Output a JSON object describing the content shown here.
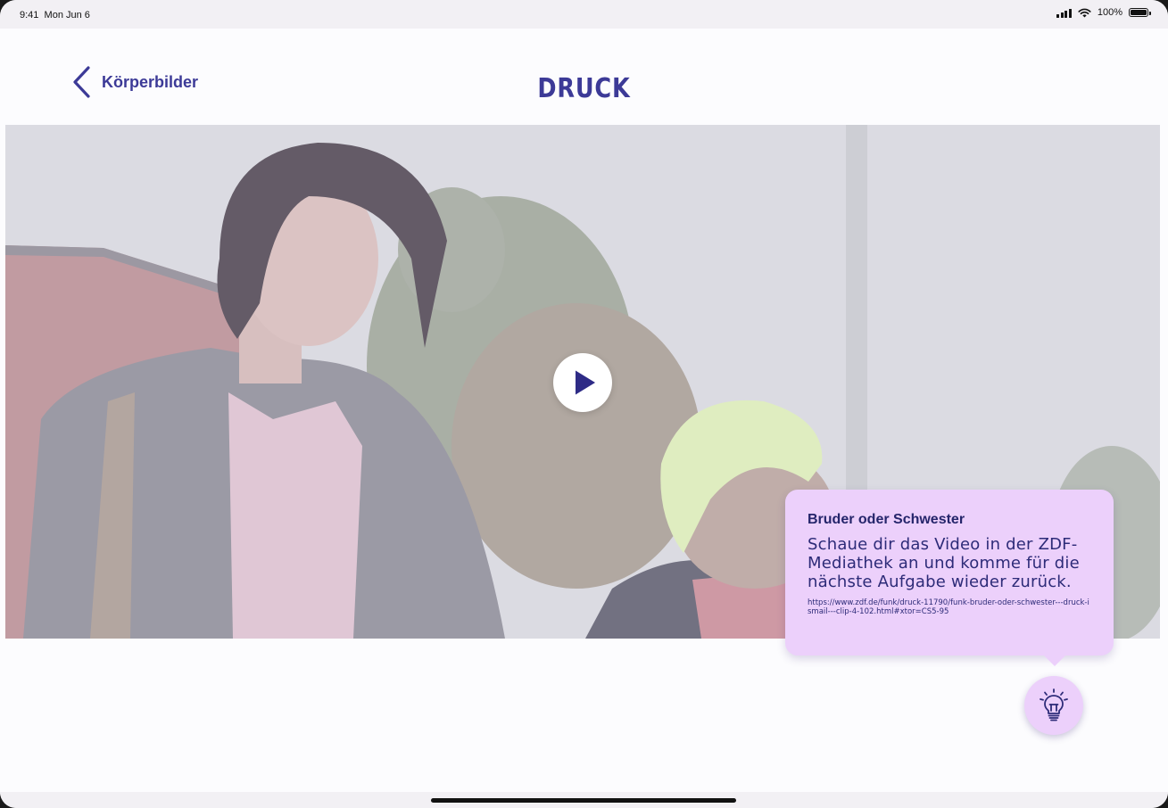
{
  "status_bar": {
    "time": "9:41",
    "date": "Mon Jun 6",
    "battery": "100%"
  },
  "nav": {
    "back_label": "Körperbilder",
    "title": "DRUCK"
  },
  "video": {
    "play_icon": "play-icon"
  },
  "tooltip": {
    "title": "Bruder oder Schwester",
    "body": "Schaue dir das Video in der ZDF-Mediathek an und komme für die nächste Aufgabe wieder zurück.",
    "link": "https://www.zdf.de/funk/druck-11790/funk-bruder-oder-schwester---druck-ismail---clip-4-102.html#xtor=CS5-95"
  },
  "hint": {
    "icon": "lightbulb-icon"
  },
  "colors": {
    "accent": "#3c3a97",
    "tooltip_bg": "#ecd0fb",
    "background": "#fcfcfe"
  }
}
